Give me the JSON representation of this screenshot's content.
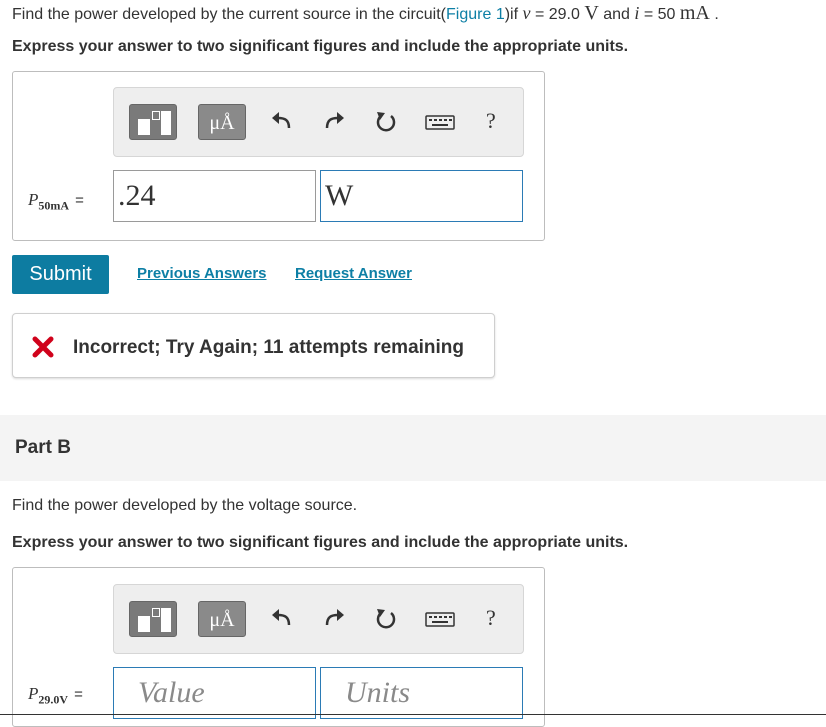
{
  "partA": {
    "question": {
      "prefix": "Find the power developed by the current source in the circuit(",
      "figure_link": "Figure 1",
      "mid1": ")if ",
      "v_symbol": "v",
      "eq1": " = 29.0 ",
      "v_unit": "V",
      "mid2": " and ",
      "i_symbol": "i",
      "eq2": " = 50 ",
      "i_unit": "mA",
      "suffix": " ."
    },
    "instruction": "Express your answer to two significant figures and include the appropriate units.",
    "toolbar": {
      "units_label": "μÅ",
      "help_label": "?"
    },
    "variable": {
      "symbol": "P",
      "subscript": "50mA",
      "equals": "="
    },
    "value_input": ".24",
    "units_input": "W",
    "submit_label": "Submit",
    "previous_answers_label": "Previous Answers",
    "request_answer_label": "Request Answer",
    "feedback": "Incorrect; Try Again; 11 attempts remaining"
  },
  "partB": {
    "title": "Part B",
    "question": "Find the power developed by the voltage source.",
    "instruction": "Express your answer to two significant figures and include the appropriate units.",
    "toolbar": {
      "units_label": "μÅ",
      "help_label": "?"
    },
    "variable": {
      "symbol": "P",
      "subscript": "29.0V",
      "equals": "="
    },
    "value_placeholder": "Value",
    "units_placeholder": "Units"
  },
  "colors": {
    "link": "#0d7fa5",
    "submit": "#0d7ca1",
    "input_border": "#2b7bb5",
    "error": "#d0021b"
  }
}
